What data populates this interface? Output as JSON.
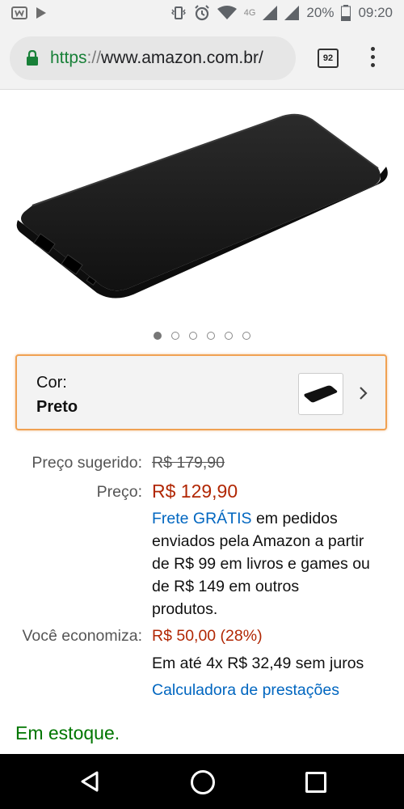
{
  "status_bar": {
    "time": "09:20",
    "battery": "20%",
    "network": "4G"
  },
  "browser": {
    "url_scheme": "https",
    "url_sep": "://",
    "url_host": "www.amazon.com.br/",
    "tab_count": "92"
  },
  "product": {
    "carousel_total": 6,
    "carousel_active": 0
  },
  "color_selector": {
    "label": "Cor:",
    "value": "Preto"
  },
  "pricing": {
    "list_label": "Preço sugerido:",
    "list_value": "R$ 179,90",
    "price_label": "Preço:",
    "price_value": "R$ 129,90",
    "shipping_link": "Frete GRÁTIS",
    "shipping_line1_rest": " em pedidos",
    "shipping_line2": "enviados pela Amazon a partir",
    "shipping_line3": "de R$ 99 em livros e games ou",
    "shipping_line4": "de R$ 149 em outros",
    "shipping_line5": "produtos.",
    "savings_label": "Você economiza:",
    "savings_value": "R$ 50,00 (28%)",
    "installments": "Em até 4x R$ 32,49 sem juros",
    "calculator_link": "Calculadora de prestações"
  },
  "availability": "Em estoque.",
  "colors": {
    "accent_orange": "#f0a152",
    "price_red": "#b12704",
    "link_blue": "#0066c0",
    "stock_green": "#007600"
  }
}
